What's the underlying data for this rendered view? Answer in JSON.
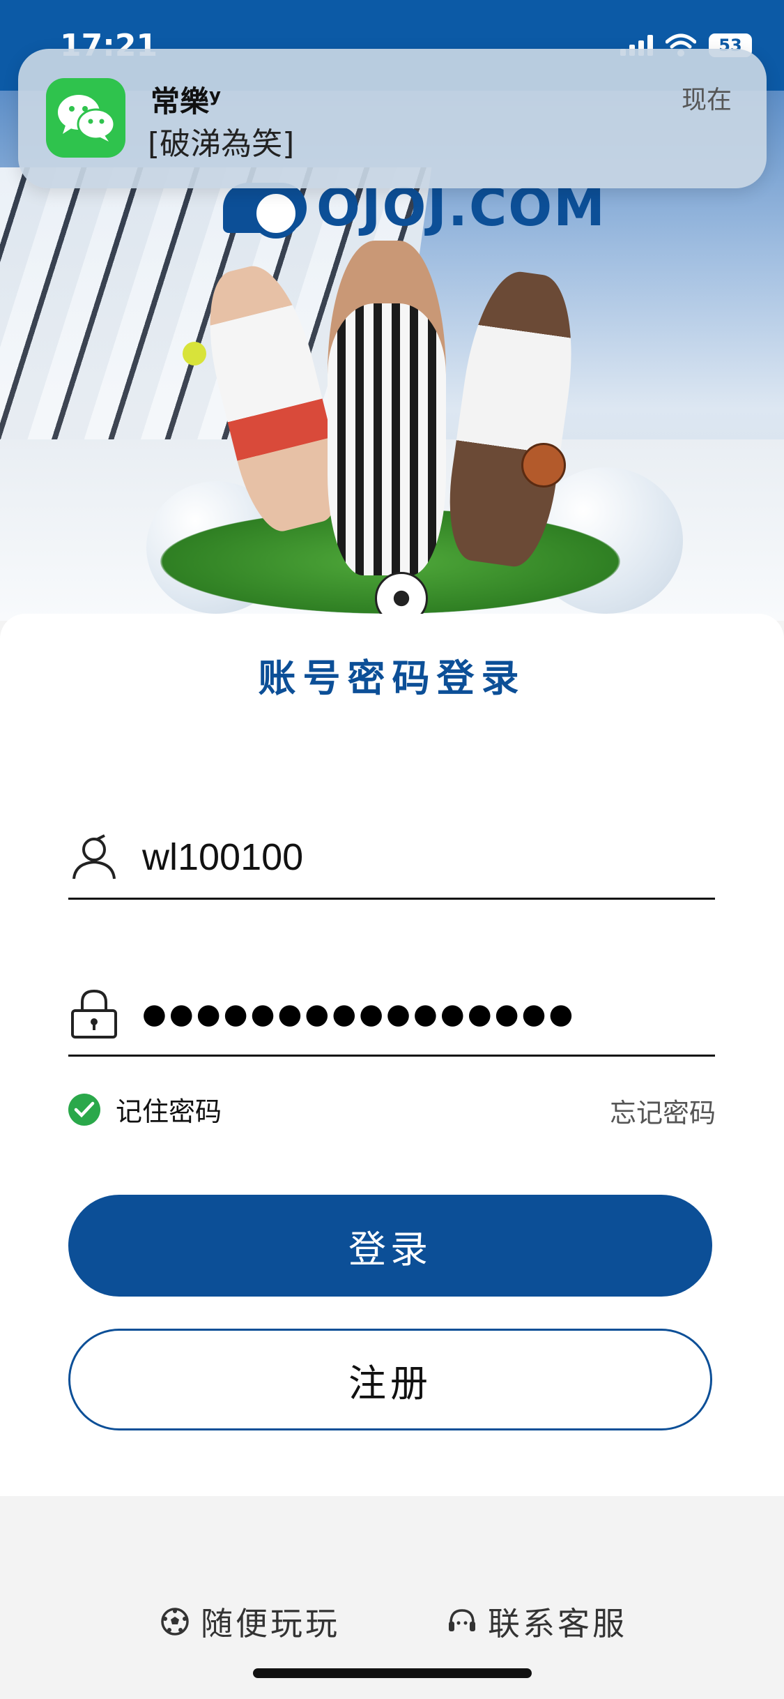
{
  "status_bar": {
    "time": "17:21",
    "battery": "53"
  },
  "notification": {
    "app_icon": "wechat-icon",
    "sender": "常樂",
    "sender_suffix": "y",
    "message": "[破涕為笑]",
    "time": "现在"
  },
  "banner": {
    "logo_text": "OJOJ.COM"
  },
  "login": {
    "title": "账号密码登录",
    "username": {
      "icon": "user-icon",
      "value": "wl100100"
    },
    "password": {
      "icon": "lock-icon",
      "masked_value": "●●●●●●●●●●●●●●●●"
    },
    "remember_label": "记住密码",
    "forgot_label": "忘记密码",
    "login_button": "登录",
    "register_button": "注册"
  },
  "bottom_links": {
    "play": {
      "icon": "soccer-ball-icon",
      "label": "随便玩玩"
    },
    "service": {
      "icon": "headset-icon",
      "label": "联系客服"
    }
  },
  "colors": {
    "brand_blue": "#0c4f97",
    "check_green": "#2aa84a",
    "notification_bg": "#c8d6e4"
  }
}
